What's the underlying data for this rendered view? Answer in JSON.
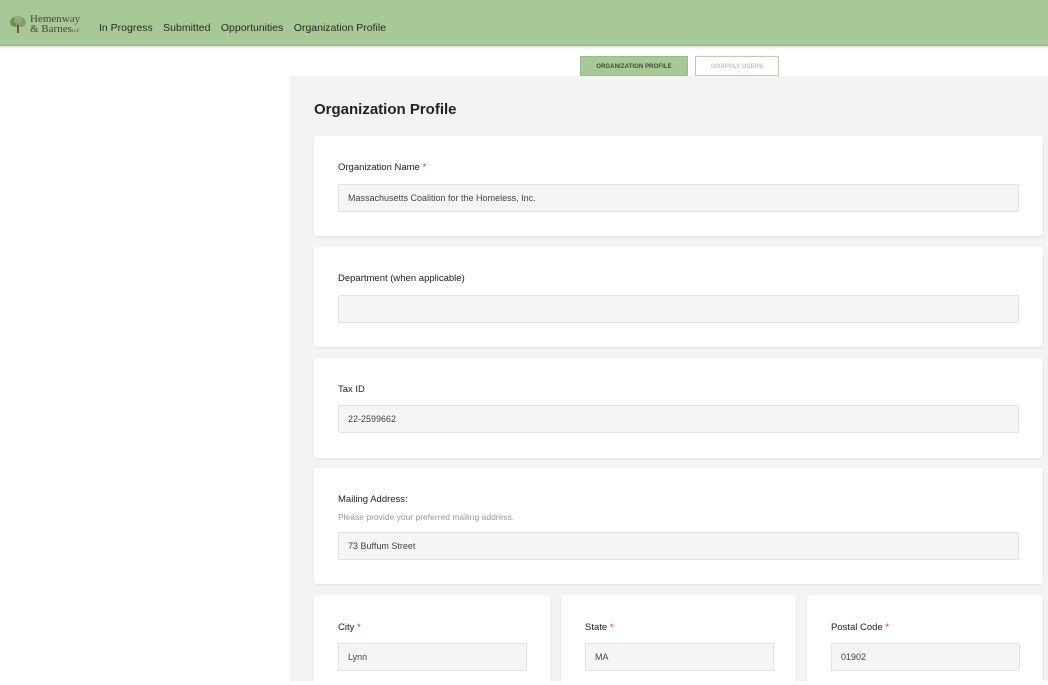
{
  "brand": {
    "logo_line1": "Hemenway",
    "logo_line2": "& Barnes",
    "logo_suffix": "LLP"
  },
  "nav": [
    "In Progress",
    "Submitted",
    "Opportunities",
    "Organization Profile"
  ],
  "tabs": [
    {
      "label": "ORGANIZATION PROFILE",
      "active": true
    },
    {
      "label": "GOAPPLY USERS",
      "active": false
    }
  ],
  "page": {
    "title": "Organization Profile"
  },
  "form": {
    "org_name": {
      "label": "Organization Name",
      "required_mark": "*",
      "value": "Massachusetts Coalition for the Homeless, Inc."
    },
    "department": {
      "label": "Department (when applicable)",
      "value": ""
    },
    "tax_id": {
      "label": "Tax ID",
      "value": "22-2599662"
    },
    "mailing": {
      "label": "Mailing Address:",
      "hint": "Please provide your preferred mailing address.",
      "value": "73 Buffum Street"
    },
    "city": {
      "label": "City",
      "required_mark": "*",
      "value": "Lynn"
    },
    "state": {
      "label": "State",
      "required_mark": "*",
      "value": "MA"
    },
    "postal": {
      "label": "Postal Code",
      "required_mark": "*",
      "value": "01902"
    }
  },
  "colors": {
    "header_bg": "#a9c898",
    "page_bg": "#f3f3f3",
    "required": "#d0333a"
  },
  "icons": {
    "logo": "tree-icon"
  }
}
